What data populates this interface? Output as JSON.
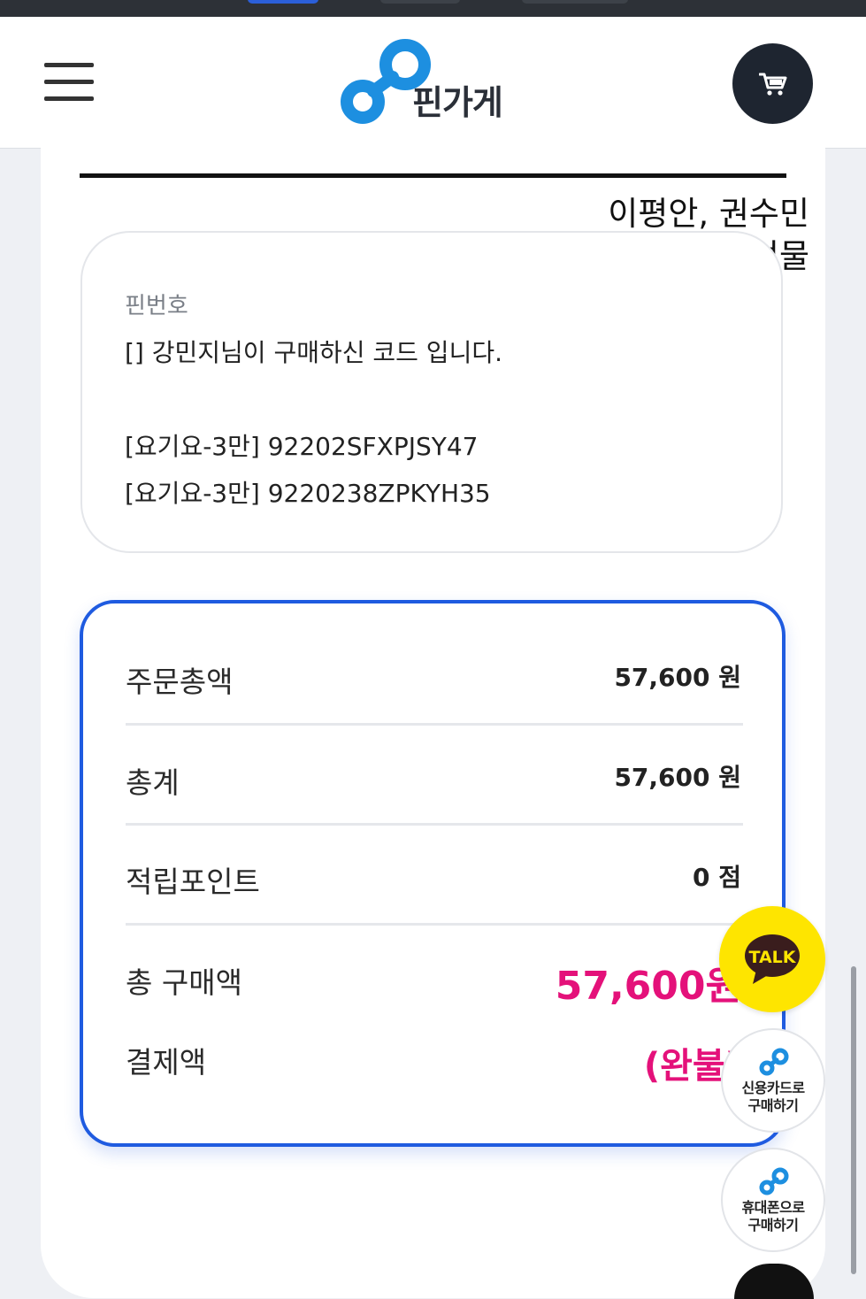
{
  "header": {
    "brand": "핀가게",
    "menu_icon": "hamburger-menu-icon",
    "cart_icon": "cart-icon"
  },
  "memo": {
    "line1": "이평안, 권수민",
    "line2": "말씀읽기 인증선물"
  },
  "pin": {
    "label": "핀번호",
    "message": "[] 강민지님이 구매하신 코드 입니다.",
    "codes": [
      "[요기요-3만] 92202SFXPJSY47",
      "[요기요-3만] 9220238ZPKYH35"
    ]
  },
  "summary": {
    "order_total_label": "주문총액",
    "order_total_value": "57,600 원",
    "total_label": "총계",
    "total_value": "57,600 원",
    "points_label": "적립포인트",
    "points_value": "0 점",
    "purchase_label": "총 구매액",
    "purchase_value": "57,600원",
    "payment_label": "결제액",
    "payment_value": "(완불)"
  },
  "floating": {
    "talk_label": "TALK",
    "card_line1": "신용카드로",
    "card_line2": "구매하기",
    "phone_line1": "휴대폰으로",
    "phone_line2": "구매하기"
  },
  "colors": {
    "accent_blue": "#1f5be0",
    "price_pink": "#e4117a",
    "kakao_yellow": "#fee500",
    "logo_blue": "#1d8fe0"
  }
}
